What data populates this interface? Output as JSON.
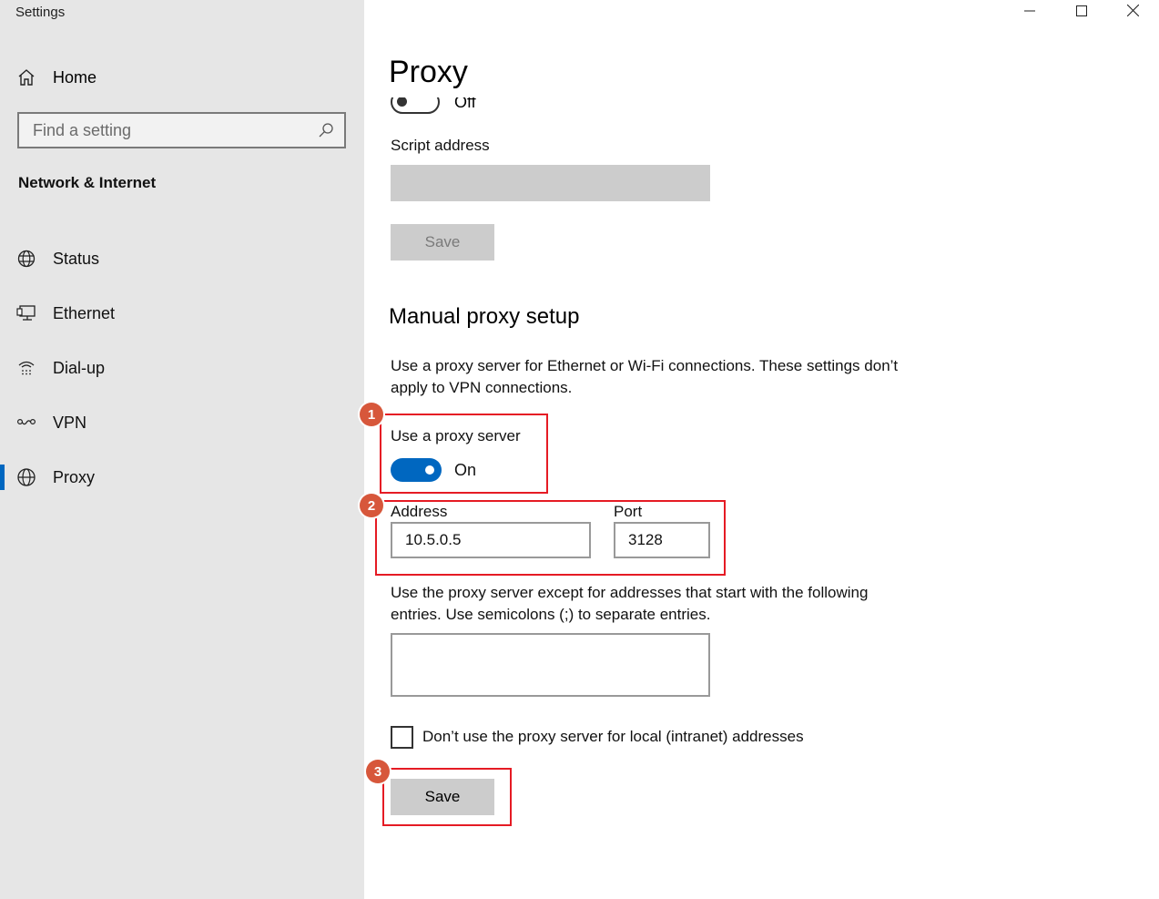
{
  "window": {
    "title": "Settings",
    "controls": [
      "minimize-icon",
      "maximize-icon",
      "close-icon"
    ]
  },
  "sidebar": {
    "home_label": "Home",
    "search_placeholder": "Find a setting",
    "section_title": "Network & Internet",
    "items": [
      {
        "label": "Status",
        "icon": "globe-status-icon",
        "active": false
      },
      {
        "label": "Ethernet",
        "icon": "ethernet-icon",
        "active": false
      },
      {
        "label": "Dial-up",
        "icon": "dialup-icon",
        "active": false
      },
      {
        "label": "VPN",
        "icon": "vpn-icon",
        "active": false
      },
      {
        "label": "Proxy",
        "icon": "globe-icon",
        "active": true
      }
    ]
  },
  "main": {
    "page_title": "Proxy",
    "auto_script_toggle_state": "Off",
    "script_address_label": "Script address",
    "script_address_value": "",
    "script_save_label": "Save",
    "manual_heading": "Manual proxy setup",
    "manual_description": "Use a proxy server for Ethernet or Wi-Fi connections. These settings don’t apply to VPN connections.",
    "use_proxy_label": "Use a proxy server",
    "use_proxy_state": "On",
    "address_label": "Address",
    "address_value": "10.5.0.5",
    "port_label": "Port",
    "port_value": "3128",
    "exceptions_description": "Use the proxy server except for addresses that start with the following entries. Use semicolons (;) to separate entries.",
    "exceptions_value": "",
    "local_bypass_label": "Don’t use the proxy server for local (intranet) addresses",
    "save_label": "Save"
  },
  "annotations": [
    {
      "number": "1"
    },
    {
      "number": "2"
    },
    {
      "number": "3"
    }
  ],
  "colors": {
    "accent": "#0067c0",
    "annotation_box": "#e51b24",
    "annotation_badge": "#d7573b",
    "sidebar_bg": "#e6e6e6"
  }
}
